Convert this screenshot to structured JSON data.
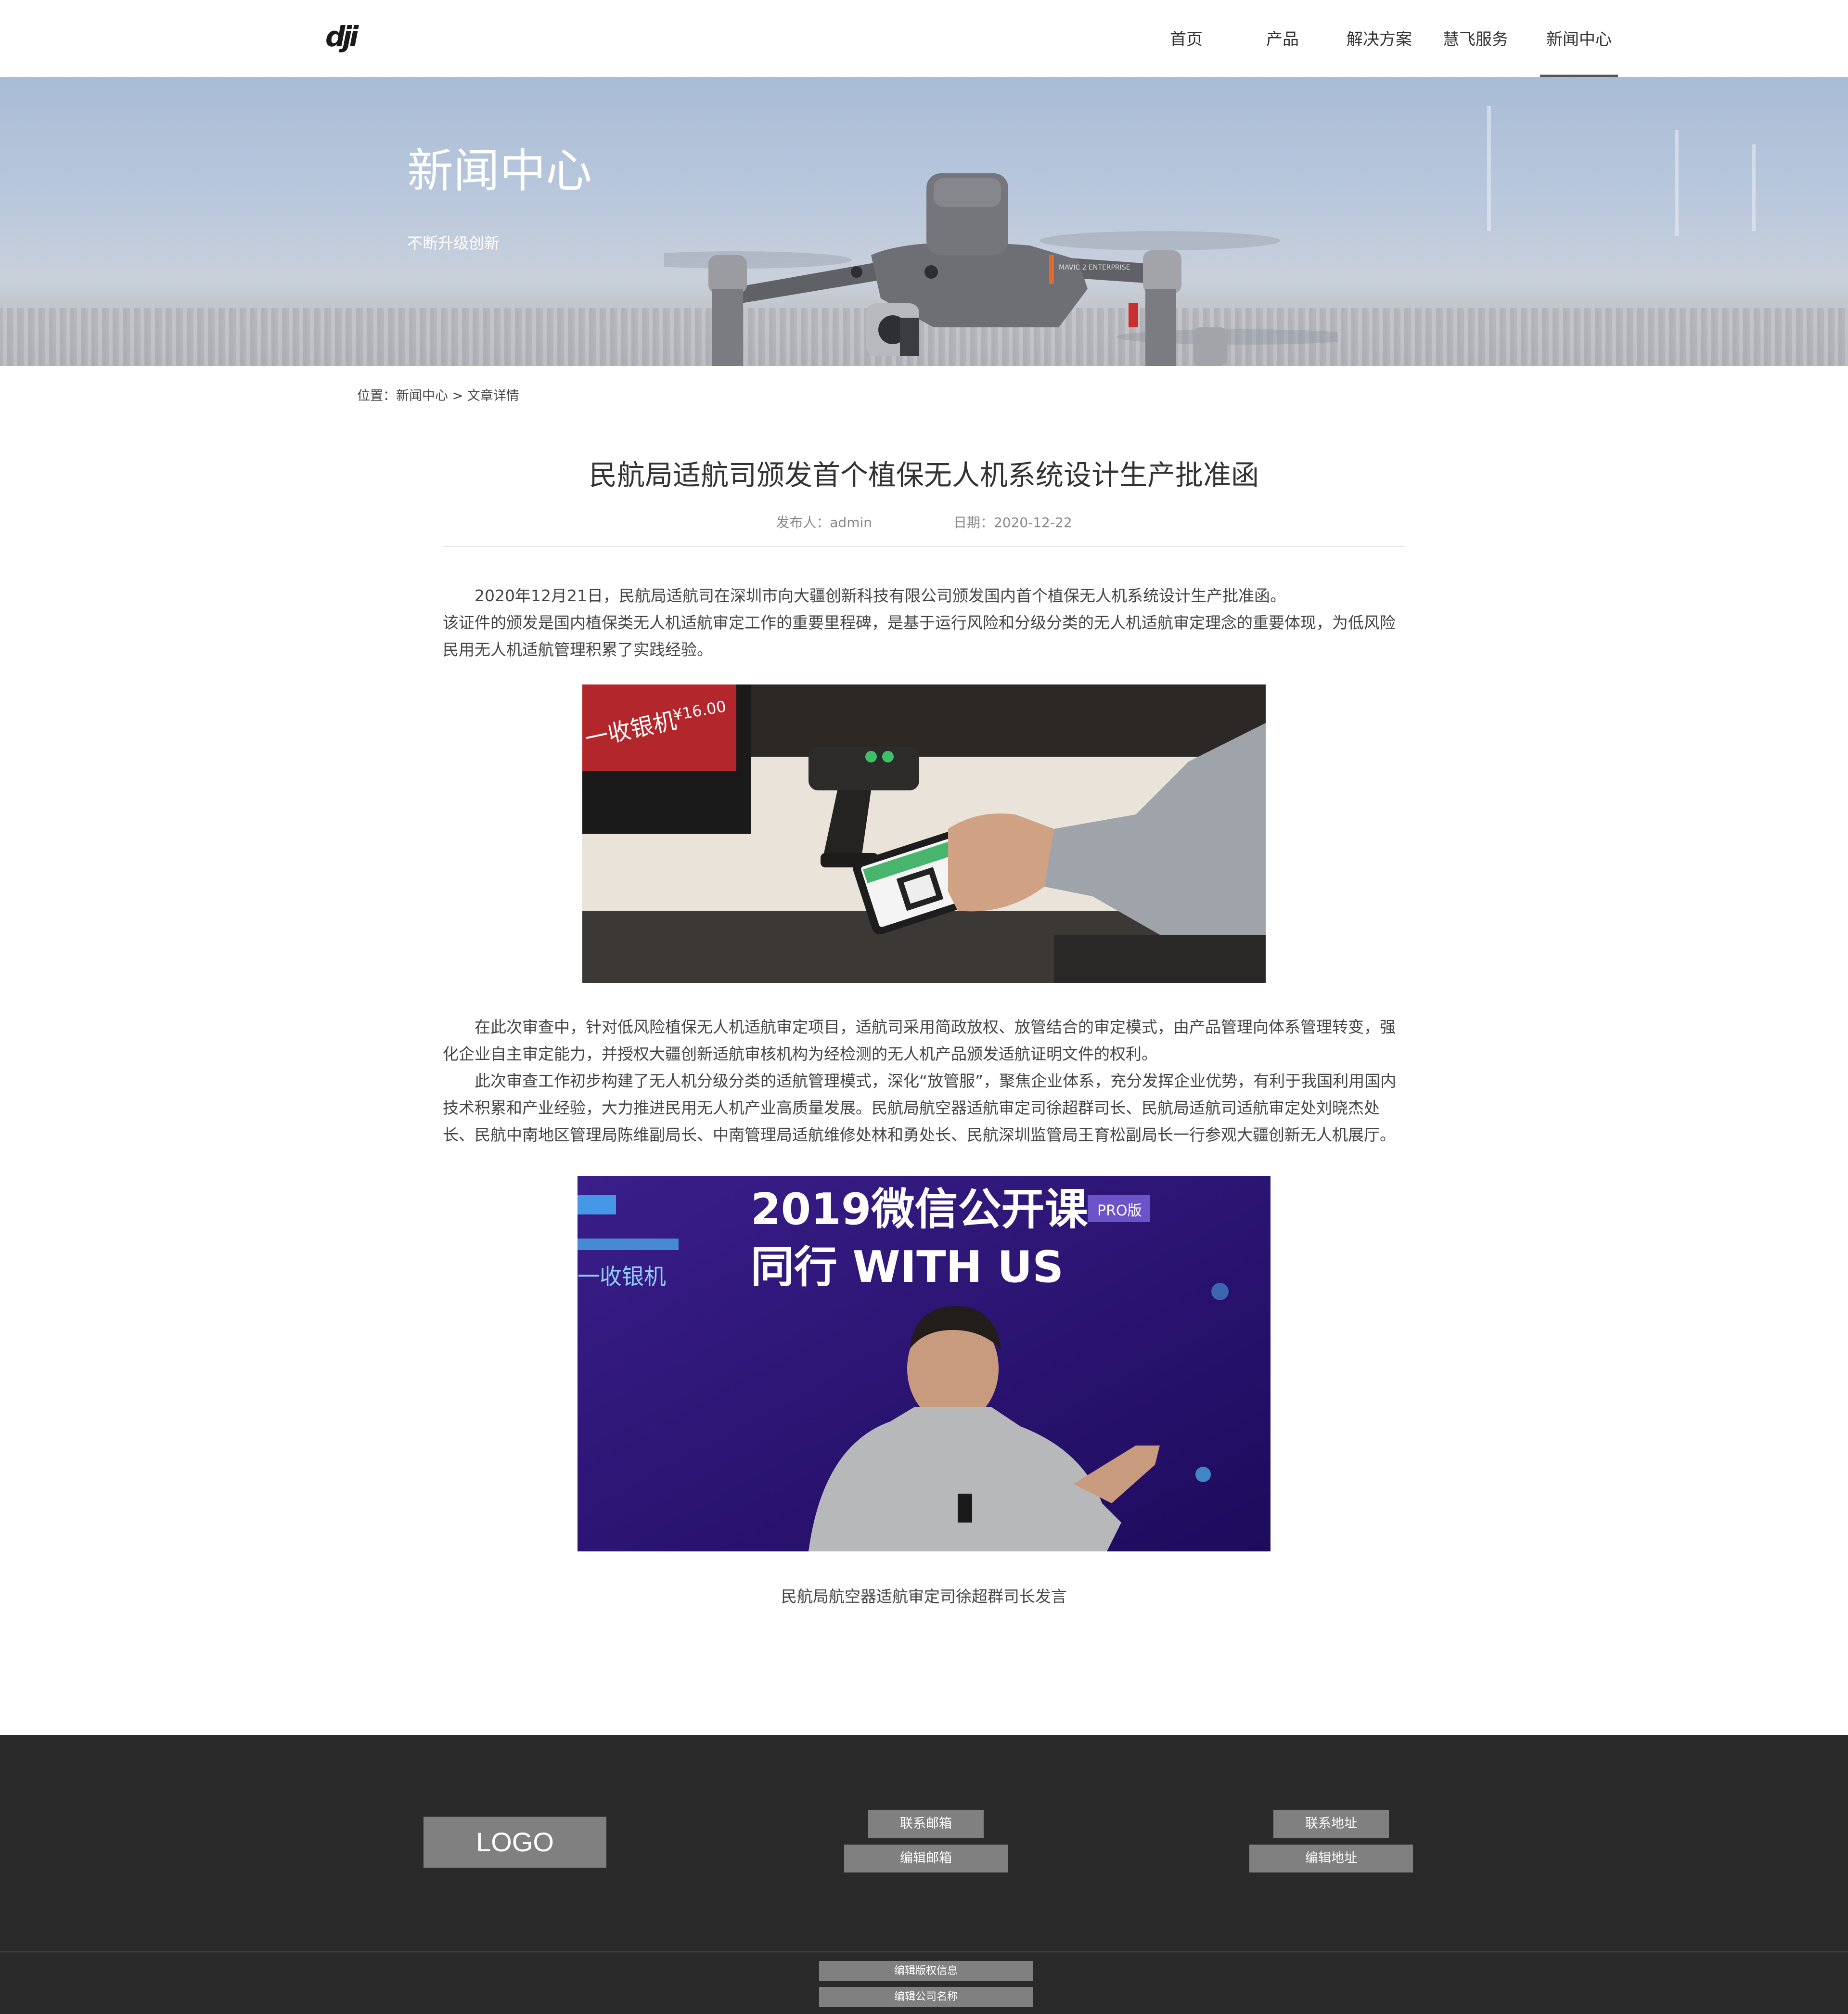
{
  "header": {
    "logo": "dji",
    "nav": [
      {
        "label": "首页"
      },
      {
        "label": "产品"
      },
      {
        "label": "解决方案"
      },
      {
        "label": "慧飞服务"
      },
      {
        "label": "新闻中心",
        "active": true
      }
    ]
  },
  "banner": {
    "title": "新闻中心",
    "subtitle": "不断升级创新",
    "drone_label": "MAVIC 2 ENTERPRISE"
  },
  "breadcrumb": "位置：新闻中心 > 文章详情",
  "article": {
    "title": "民航局适航司颁发首个植保无人机系统设计生产批准函",
    "author": "发布人：admin",
    "date": "日期：2020-12-22",
    "paragraphs_1": [
      "2020年12月21日，民航局适航司在深圳市向大疆创新科技有限公司颁发国内首个植保无人机系统设计生产批准函。",
      "该证件的颁发是国内植保类无人机适航审定工作的重要里程碑，是基于运行风险和分级分类的无人机适航审定理念的重要体现，为低风险民用无人机适航管理积累了实践经验。"
    ],
    "photo1": {
      "sign": "一收银机",
      "price": "¥16.00"
    },
    "paragraphs_2": [
      "在此次审查中，针对低风险植保无人机适航审定项目，适航司采用简政放权、放管结合的审定模式，由产品管理向体系管理转变，强化企业自主审定能力，并授权大疆创新适航审核机构为经检测的无人机产品颁发适航证明文件的权利。",
      "此次审查工作初步构建了无人机分级分类的适航管理模式，深化“放管服”，聚焦企业体系，充分发挥企业优势，有利于我国利用国内技术积累和产业经验，大力推进民用无人机产业高质量发展。民航局航空器适航审定司徐超群司长、民航局适航司适航审定处刘晓杰处长、民航中南地区管理局陈维副局长、中南管理局适航维修处林和勇处长、民航深圳监管局王育松副局长一行参观大疆创新无人机展厅。"
    ],
    "photo2": {
      "line1": "2019微信公开课",
      "badge": "PRO版",
      "line2": "同行 WITH US",
      "left_sign": "一收银机"
    },
    "caption": "民航局航空器适航审定司徐超群司长发言"
  },
  "footer": {
    "logo": "LOGO",
    "email_label": "联系邮箱",
    "email_edit": "编辑邮箱",
    "address_label": "联系地址",
    "address_edit": "编辑地址",
    "copyright": "编辑版权信息",
    "company": "编辑公司名称"
  },
  "colors": {
    "footer_bg": "#2a2a2a",
    "footer_box": "#808080",
    "nav_active_underline": "#555555"
  }
}
